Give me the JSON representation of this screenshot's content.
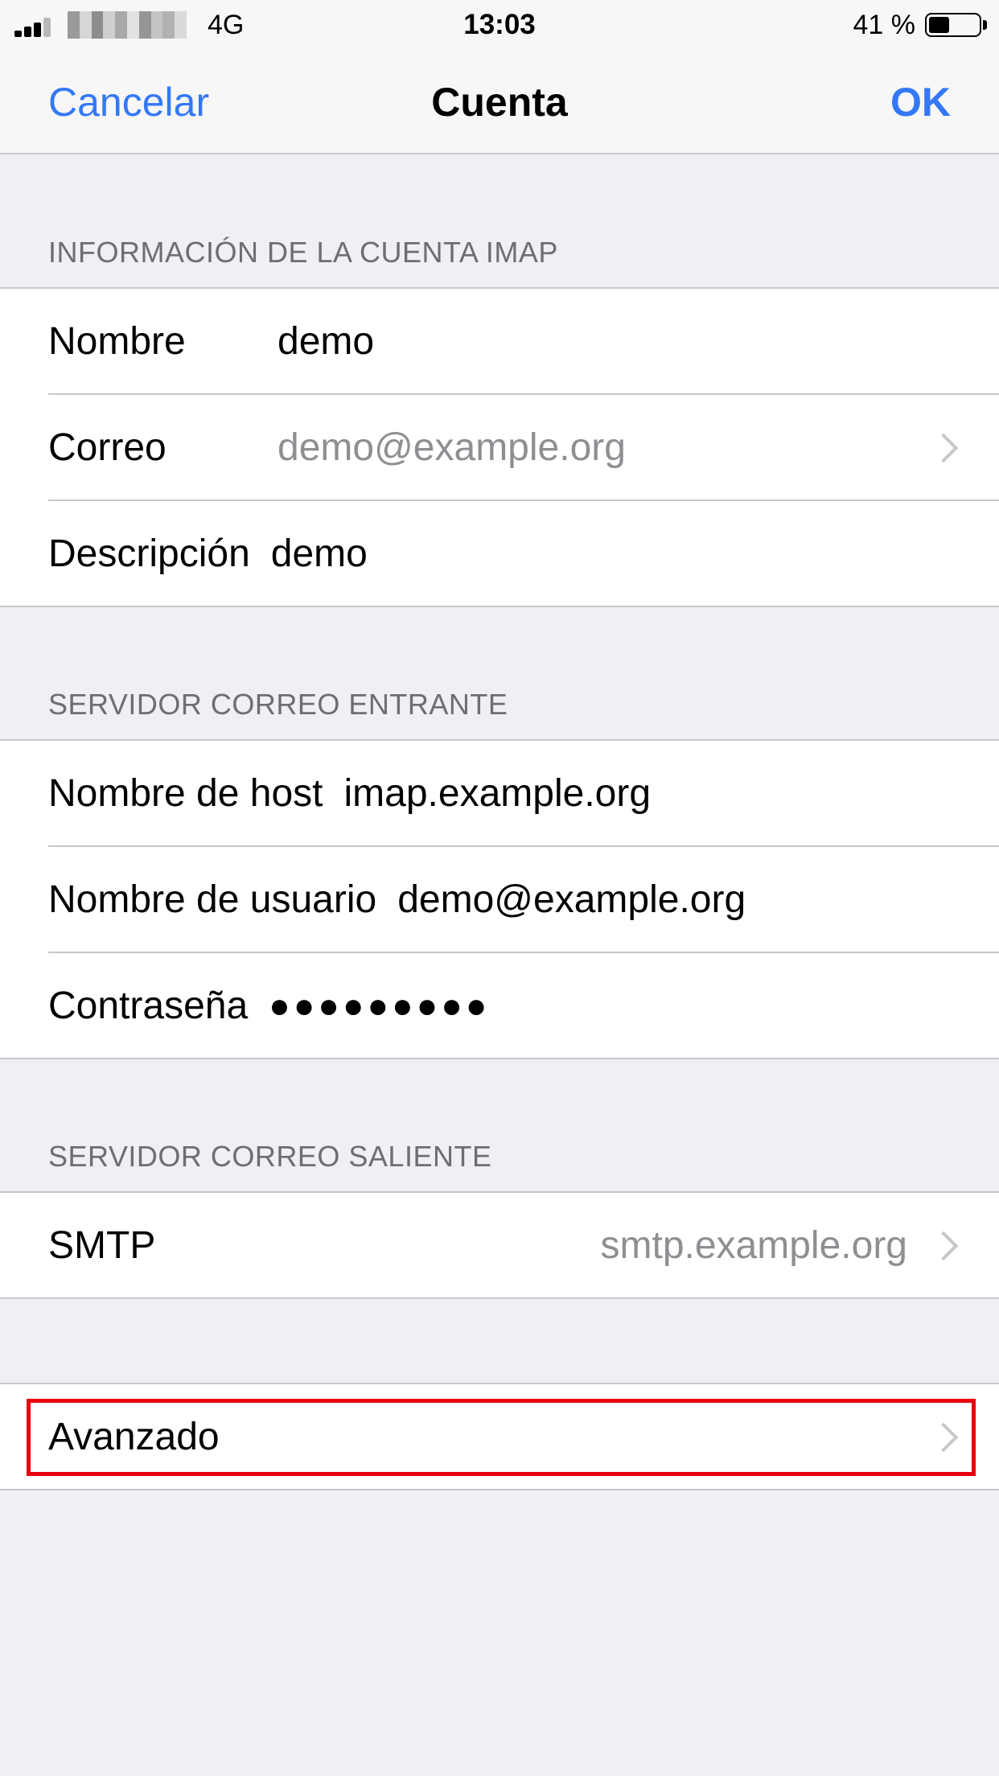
{
  "status_bar": {
    "network": "4G",
    "time": "13:03",
    "battery": "41 %",
    "battery_level": 0.41
  },
  "nav": {
    "cancel_label": "Cancelar",
    "title": "Cuenta",
    "ok_label": "OK"
  },
  "account_section": {
    "header": "INFORMACIÓN DE LA CUENTA IMAP",
    "rows": [
      {
        "label": "Nombre",
        "value": "demo"
      },
      {
        "label": "Correo",
        "value": "demo@example.org"
      },
      {
        "label": "Descripción",
        "value": "demo"
      }
    ]
  },
  "incoming_section": {
    "header": "SERVIDOR CORREO ENTRANTE",
    "rows": [
      {
        "label": "Nombre de host",
        "value": "imap.example.org"
      },
      {
        "label": "Nombre de usuario",
        "value": "demo@example.org"
      },
      {
        "label": "Contraseña",
        "value": "●●●●●●●●●"
      }
    ]
  },
  "outgoing_section": {
    "header": "SERVIDOR CORREO SALIENTE",
    "rows": [
      {
        "label": "SMTP",
        "value": "smtp.example.org"
      }
    ]
  },
  "advanced": {
    "label": "Avanzado"
  },
  "colors": {
    "accent": "#3478f6",
    "highlight": "#e8000f",
    "background": "#efeff4"
  },
  "icons": {
    "signal": "cellular-signal-icon",
    "battery": "battery-icon",
    "chevron": "chevron-right-icon"
  }
}
